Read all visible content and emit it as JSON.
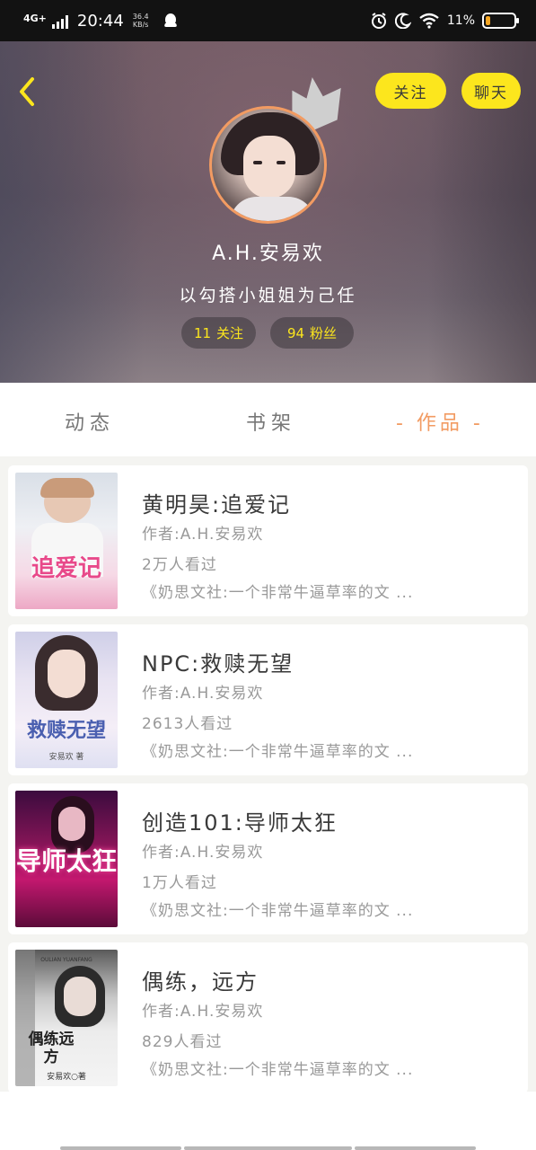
{
  "status_bar": {
    "network": "4G+",
    "time": "20:44",
    "speed_value": "36.4",
    "speed_unit": "KB/s",
    "battery_pct": "11%",
    "battery_level": 0.11
  },
  "header": {
    "follow_label": "关注",
    "chat_label": "聊天",
    "username": "A.H.安易欢",
    "bio": "以勾搭小姐姐为己任",
    "following_count": "11",
    "following_label": "关注",
    "fans_count": "94",
    "fans_label": "粉丝"
  },
  "tabs": [
    {
      "label": "动态",
      "active": false
    },
    {
      "label": "书架",
      "active": false
    },
    {
      "label": "- 作品 -",
      "active": true
    }
  ],
  "books": [
    {
      "title": "黄明昊:追爱记",
      "author": "作者:A.H.安易欢",
      "views": "2万人看过",
      "desc": "《奶思文社:一个非常牛逼草率的文 ...",
      "cover_text": "追爱记"
    },
    {
      "title": "NPC:救赎无望",
      "author": "作者:A.H.安易欢",
      "views": "2613人看过",
      "desc": "《奶思文社:一个非常牛逼草率的文 ...",
      "cover_text": "救赎无望",
      "cover_sub": "安易欢 著"
    },
    {
      "title": "创造101:导师太狂",
      "author": "作者:A.H.安易欢",
      "views": "1万人看过",
      "desc": "《奶思文社:一个非常牛逼草率的文 ...",
      "cover_text": "导师太狂"
    },
    {
      "title": "偶练，远方",
      "author": "作者:A.H.安易欢",
      "views": "829人看过",
      "desc": "《奶思文社:一个非常牛逼草率的文 ...",
      "cover_top": "OULIAN YUANFANG",
      "cover_text": "偶练远方",
      "cover_sub": "安易欢○著"
    }
  ],
  "colors": {
    "accent_yellow": "#fce61d",
    "accent_orange": "#f29b62",
    "text_gray": "#999999"
  }
}
